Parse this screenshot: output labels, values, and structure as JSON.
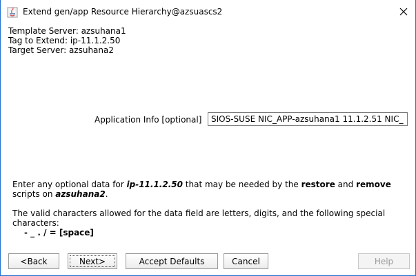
{
  "window": {
    "title": "Extend gen/app Resource Hierarchy@azsuascs2"
  },
  "info": {
    "template_server": "Template Server: azsuhana1",
    "tag_to_extend": "Tag to Extend: ip-11.1.2.50",
    "target_server": "Target Server: azsuhana2"
  },
  "app_info": {
    "label": "Application Info [optional]",
    "value": "SIOS-SUSE NIC_APP-azsuhana1 11.1.2.51 NIC_"
  },
  "description": {
    "p1_a": "Enter any optional data for ",
    "p1_tag": "ip-11.1.2.50",
    "p1_b": " that may be needed by the ",
    "p1_restore": "restore",
    "p1_c": " and ",
    "p1_remove": "remove",
    "p1_d": "scripts on ",
    "p1_server": "azsuhana2",
    "p1_e": ".",
    "p2": "The valid characters allowed for the data field are letters, digits, and the following special characters:",
    "chars": "- _ . / = [space]"
  },
  "buttons": {
    "back": "<Back",
    "next": "Next>",
    "accept_defaults": "Accept Defaults",
    "cancel": "Cancel",
    "help": "Help"
  }
}
